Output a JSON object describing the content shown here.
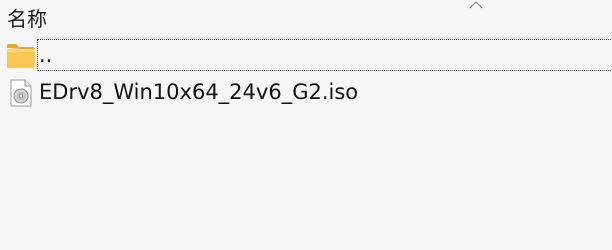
{
  "list": {
    "column_header": "名称",
    "rows": [
      {
        "label": "..",
        "icon": "folder-icon"
      },
      {
        "label": "EDrv8_Win10x64_24v6_G2.iso",
        "icon": "disc-image-icon"
      }
    ]
  },
  "colors": {
    "background": "#f6f6f6",
    "folder": "#f7c85a",
    "text": "#111111"
  }
}
